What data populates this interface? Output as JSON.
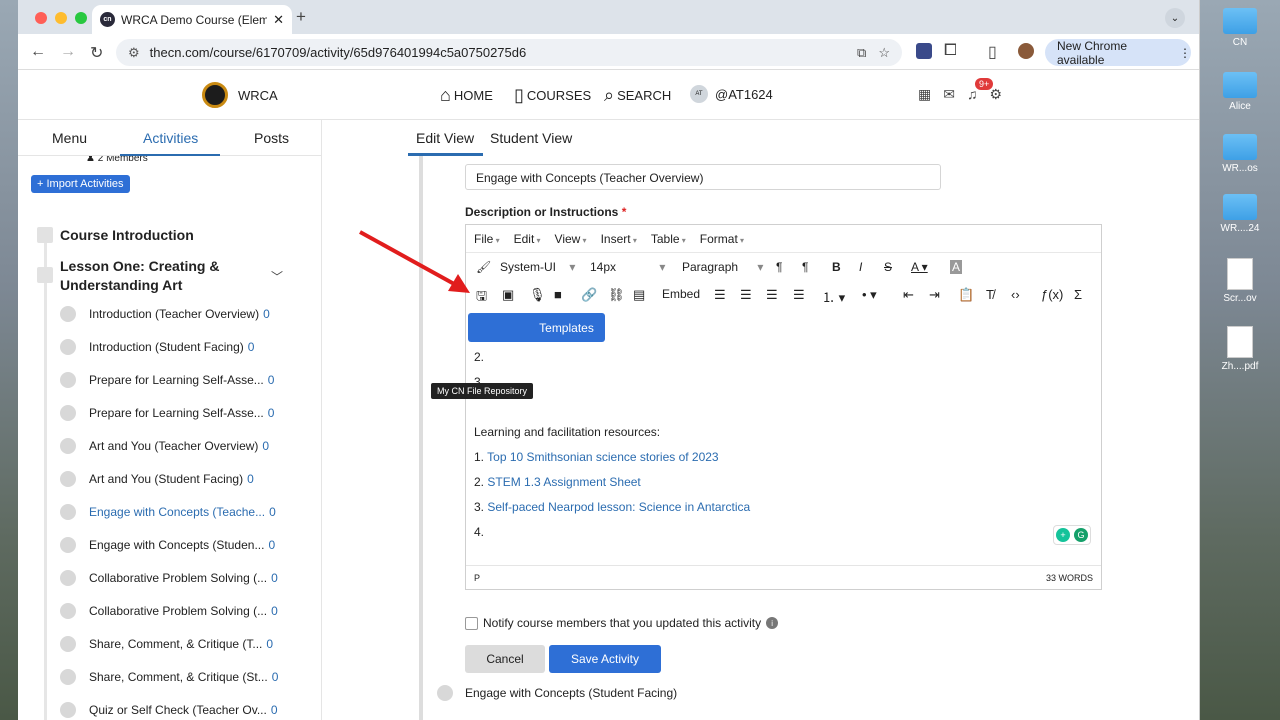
{
  "browser": {
    "tab_title": "WRCA Demo Course (Elemen",
    "url": "thecn.com/course/6170709/activity/65d976401994c5a0750275d6",
    "update_label": "New Chrome available"
  },
  "site": {
    "brand": "WRCA",
    "nav": [
      "HOME",
      "COURSES",
      "SEARCH",
      "@AT1624"
    ],
    "avatar_text": "AT",
    "notif_count": "9+"
  },
  "sidebar": {
    "tabs": [
      "Menu",
      "Activities",
      "Posts"
    ],
    "members": "2 Members",
    "import_label": "+ Import Activities",
    "sections": [
      {
        "title": "Course Introduction"
      },
      {
        "title": "Lesson One: Creating & Understanding Art"
      }
    ],
    "items": [
      {
        "label": "Introduction (Teacher Overview)",
        "count": "0"
      },
      {
        "label": "Introduction (Student Facing)",
        "count": "0"
      },
      {
        "label": "Prepare for Learning Self-Asse...",
        "count": "0"
      },
      {
        "label": "Prepare for Learning Self-Asse...",
        "count": "0"
      },
      {
        "label": "Art and You (Teacher Overview)",
        "count": "0"
      },
      {
        "label": "Art and You (Student Facing)",
        "count": "0"
      },
      {
        "label": "Engage with Concepts (Teache...",
        "count": "0"
      },
      {
        "label": "Engage with Concepts (Studen...",
        "count": "0"
      },
      {
        "label": "Collaborative Problem Solving (...",
        "count": "0"
      },
      {
        "label": "Collaborative Problem Solving (...",
        "count": "0"
      },
      {
        "label": "Share, Comment, & Critique (T...",
        "count": "0"
      },
      {
        "label": "Share, Comment, & Critique (St...",
        "count": "0"
      },
      {
        "label": "Quiz or Self Check (Teacher Ov...",
        "count": "0"
      }
    ]
  },
  "content": {
    "tabs": [
      "Edit View",
      "Student View"
    ],
    "title_value": "Engage with Concepts (Teacher Overview)",
    "desc_label": "Description or Instructions",
    "editor": {
      "menus": [
        "File",
        "Edit",
        "View",
        "Insert",
        "Table",
        "Format"
      ],
      "font": "System-UI",
      "size": "14px",
      "block": "Paragraph",
      "embed": "Embed",
      "tooltip": "My CN File Repository",
      "templates": "Templates",
      "lines": [
        "2.",
        "3.",
        "",
        "Learning and facilitation resources:"
      ],
      "links": [
        {
          "num": "1.",
          "text": "Top 10 Smithsonian science stories of 2023"
        },
        {
          "num": "2.",
          "text": "STEM 1.3 Assignment Sheet"
        },
        {
          "num": "3.",
          "text": "Self-paced Nearpod lesson: Science in Antarctica"
        }
      ],
      "last": "4.",
      "path": "P",
      "words": "33 WORDS"
    },
    "notify": "Notify course members that you updated this activity",
    "cancel": "Cancel",
    "save": "Save Activity",
    "next": "Engage with Concepts (Student Facing)"
  },
  "desktop": [
    "CN",
    "Alice",
    "WR...os",
    "WR....24",
    "Scr...ov",
    "Zh....pdf"
  ],
  "colors": {
    "accent": "#2e6fd6",
    "link": "#2b6cb0",
    "arrow": "#e11d1d"
  }
}
